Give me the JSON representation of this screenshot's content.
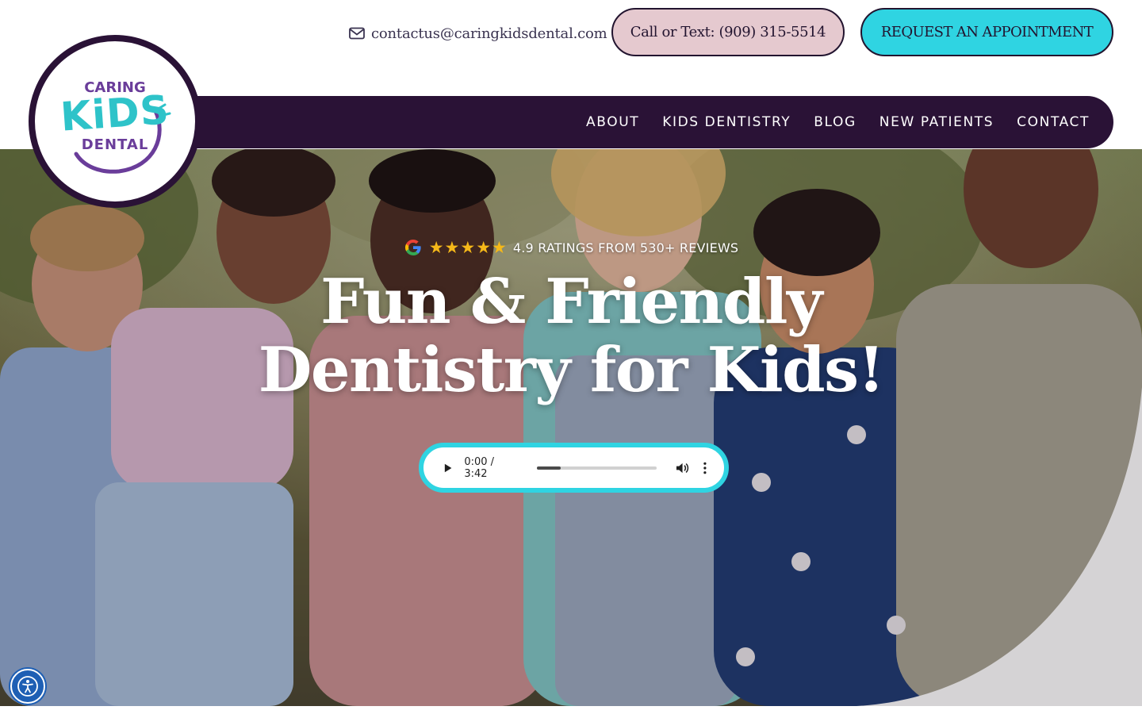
{
  "header": {
    "email": "contactus@caringkidsdental.com",
    "call_button": "Call or Text: (909) 315-5514",
    "appointment_button": "REQUEST AN APPOINTMENT"
  },
  "logo": {
    "line1": "CARING",
    "line2": "KiDS",
    "line3": "DENTAL"
  },
  "nav": {
    "items": [
      "ABOUT",
      "KIDS DENTISTRY",
      "BLOG",
      "NEW PATIENTS",
      "CONTACT"
    ]
  },
  "hero": {
    "rating_text": "4.9 RATINGS FROM 530+ REVIEWS",
    "star_count": 5,
    "title_line1": "Fun & Friendly",
    "title_line2": "Dentistry for Kids!"
  },
  "audio": {
    "time": "0:00 / 3:42",
    "buffered_fraction": 0.2
  },
  "colors": {
    "brand_dark": "#2a1236",
    "accent_cyan": "#2fd4e2",
    "call_pink": "#e5c9cf",
    "logo_purple": "#6a3d9a",
    "logo_teal": "#2ec3c9",
    "star_gold": "#f5b819"
  },
  "icons": {
    "email": "envelope-icon",
    "google": "google-icon",
    "rating": "star-icon",
    "accessibility": "accessibility-icon",
    "play": "play-icon",
    "volume": "volume-icon",
    "more": "more-vertical-icon"
  }
}
